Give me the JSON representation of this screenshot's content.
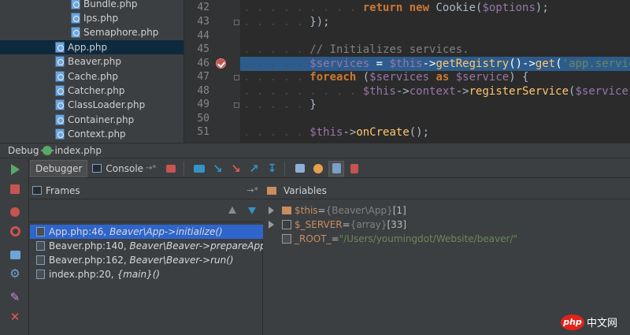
{
  "project_tree": {
    "items": [
      {
        "label": "Bundle.php",
        "indent": 2,
        "selected": false
      },
      {
        "label": "Ips.php",
        "indent": 2,
        "selected": false
      },
      {
        "label": "Semaphore.php",
        "indent": 2,
        "selected": false
      },
      {
        "label": "App.php",
        "indent": 1,
        "selected": true
      },
      {
        "label": "Beaver.php",
        "indent": 1,
        "selected": false
      },
      {
        "label": "Cache.php",
        "indent": 1,
        "selected": false
      },
      {
        "label": "Catcher.php",
        "indent": 1,
        "selected": false
      },
      {
        "label": "ClassLoader.php",
        "indent": 1,
        "selected": false
      },
      {
        "label": "Container.php",
        "indent": 1,
        "selected": false
      },
      {
        "label": "Context.php",
        "indent": 1,
        "selected": false
      }
    ]
  },
  "editor": {
    "line_numbers": [
      "42",
      "43",
      "44",
      "45",
      "46",
      "47",
      "48",
      "49",
      "50",
      "51"
    ],
    "breakpoint_line": "46",
    "lines": {
      "l42": {
        "kw1": "return",
        "kw2": "new",
        "cls": "Cookie(",
        "var": "$options",
        "end": ");"
      },
      "l43": {
        "text": "});"
      },
      "l45": {
        "comment": "// Initializes services."
      },
      "l46": {
        "var1": "$services",
        "eq": " = ",
        "var2": "$this",
        "arrow": "->",
        "fn1": "getRegistry",
        "mid": "()->",
        "fn2": "get",
        "paren": "(",
        "str": "'app.servic"
      },
      "l47": {
        "kw": "foreach",
        "open": " (",
        "var1": "$services",
        "as": " as ",
        "var2": "$service",
        "close": ") {"
      },
      "l48": {
        "var1": "$this",
        "arrow": "->",
        "prop": "context",
        "arrow2": "->",
        "fn": "registerService",
        "open": "(",
        "var2": "$service",
        "close": ");"
      },
      "l49": {
        "text": "}"
      },
      "l51": {
        "var": "$this",
        "arrow": "->",
        "fn": "onCreate",
        "end": "();"
      }
    }
  },
  "debug": {
    "title_prefix": "Debug",
    "config_name": "index.php",
    "tabs": {
      "debugger": "Debugger",
      "console": "Console"
    },
    "frames_header": "Frames",
    "variables_header": "Variables",
    "frames": [
      {
        "file": "App.php:46,",
        "func": "Beaver\\App->initialize()",
        "selected": true
      },
      {
        "file": "Beaver.php:140,",
        "func": "Beaver\\Beaver->prepareApp(",
        "selected": false
      },
      {
        "file": "Beaver.php:162,",
        "func": "Beaver\\Beaver->run()",
        "selected": false
      },
      {
        "file": "index.php:20,",
        "func": "{main}()",
        "selected": false
      }
    ],
    "variables": [
      {
        "name": "$this",
        "eq": " = ",
        "type": "{Beaver\\App}",
        "value": " [1]",
        "expandable": true
      },
      {
        "name": "$_SERVER",
        "eq": " = ",
        "type": "{array}",
        "value": " [33]",
        "expandable": true
      },
      {
        "name": "_ROOT_",
        "eq": " = ",
        "type": "",
        "value": "\"/Users/youmingdot/Website/beaver/\"",
        "expandable": false
      }
    ]
  },
  "watermark": {
    "logo": "php",
    "text": "中文网"
  },
  "colors": {
    "accent": "#2f65ca",
    "breakpoint": "#c75450",
    "run": "#59a869",
    "selection": "#2d5c8c"
  }
}
